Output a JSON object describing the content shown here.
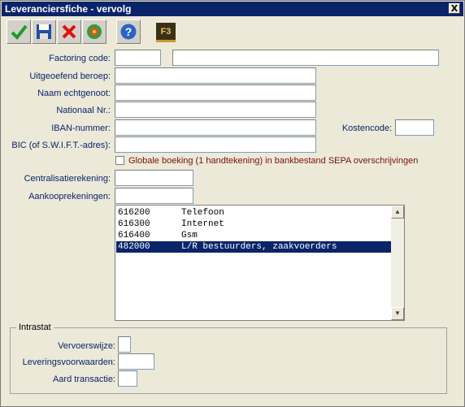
{
  "window": {
    "title": "Leveranciersfiche - vervolg",
    "close_glyph": "X"
  },
  "toolbar": {
    "buttons": [
      {
        "name": "confirm-button",
        "icon": "checkmark-icon"
      },
      {
        "name": "save-button",
        "icon": "floppy-disk-icon"
      },
      {
        "name": "cancel-button",
        "icon": "red-x-icon"
      },
      {
        "name": "refresh-button",
        "icon": "color-circle-icon"
      },
      {
        "name": "help-button",
        "icon": "question-icon"
      }
    ],
    "f3_label": "F3"
  },
  "form": {
    "factoring_code_label": "Factoring code:",
    "factoring_code_value": "",
    "factoring_desc_value": "",
    "beroep_label": "Uitgeoefend beroep:",
    "beroep_value": "",
    "echtgenoot_label": "Naam echtgenoot:",
    "echtgenoot_value": "",
    "nationaal_label": "Nationaal Nr.:",
    "nationaal_value": "",
    "iban_label": "IBAN-nummer:",
    "iban_value": "",
    "kostencode_label": "Kostencode:",
    "kostencode_value": "",
    "bic_label": "BIC (of S.W.I.F.T.-adres):",
    "bic_value": "",
    "globale_label": "Globale boeking (1 handtekening) in bankbestand SEPA overschrijvingen",
    "globale_checked": false,
    "centralisatie_label": "Centralisatierekening:",
    "centralisatie_value": "",
    "aankoop_label": "Aankooprekeningen:",
    "aankoop_value": ""
  },
  "accounts": [
    {
      "code": "616200",
      "name": "Telefoon",
      "selected": false
    },
    {
      "code": "616300",
      "name": "Internet",
      "selected": false
    },
    {
      "code": "616400",
      "name": "Gsm",
      "selected": false
    },
    {
      "code": "482000",
      "name": "L/R bestuurders, zaakvoerders",
      "selected": true
    }
  ],
  "intrastat": {
    "title": "Intrastat",
    "vervoer_label": "Vervoerswijze:",
    "vervoer_value": "",
    "levering_label": "Leveringsvoorwaarden:",
    "levering_value": "",
    "aard_label": "Aard transactie:",
    "aard_value": ""
  },
  "colors": {
    "titlebar": "#0a246a",
    "selection": "#0a246a",
    "label_blue": "#0a246a",
    "checkbox_label": "#7b1010"
  }
}
